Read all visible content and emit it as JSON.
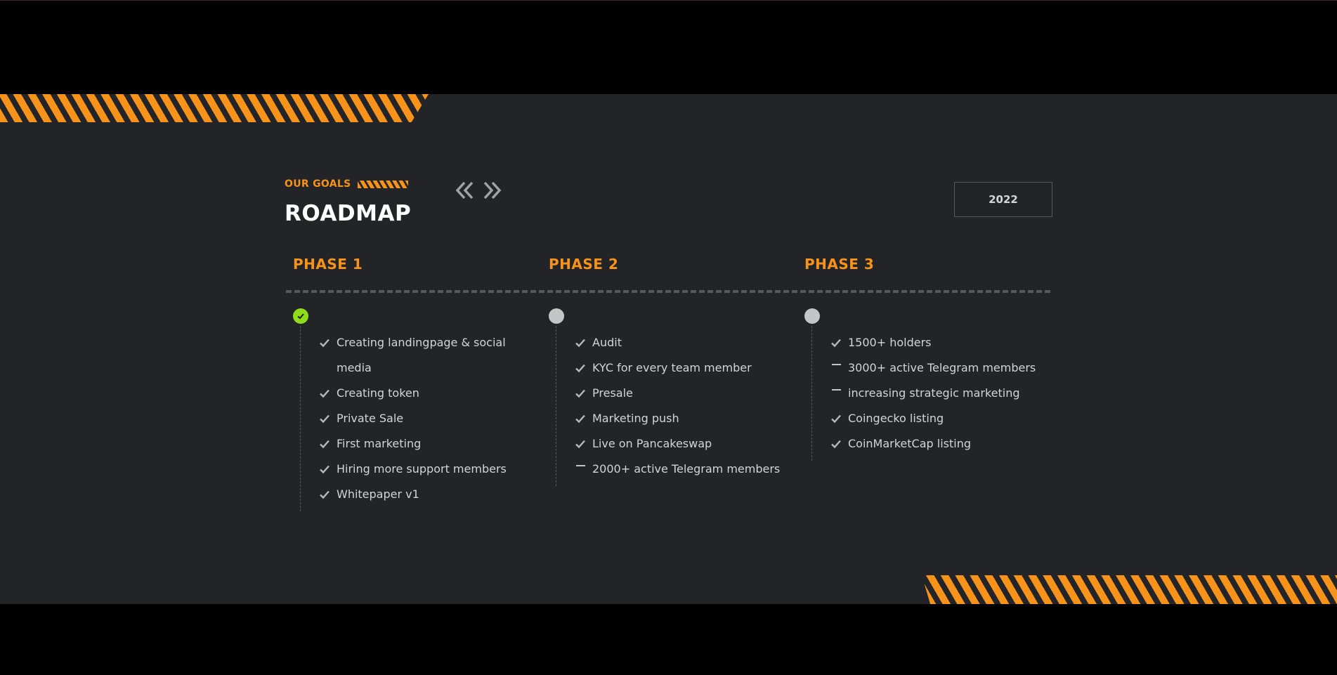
{
  "header": {
    "eyebrow": "OUR GOALS",
    "title": "ROADMAP",
    "year": "2022"
  },
  "colors": {
    "accent": "#f7931a",
    "done": "#8fdc1a",
    "pending": "#c4c5c7",
    "background": "#222428"
  },
  "phases": [
    {
      "title": "PHASE 1",
      "status": "done",
      "items": [
        {
          "text": "Creating landingpage & social media",
          "icon": "check-icon"
        },
        {
          "text": "Creating token",
          "icon": "check-icon"
        },
        {
          "text": "Private Sale",
          "icon": "check-icon"
        },
        {
          "text": "First marketing",
          "icon": "check-icon"
        },
        {
          "text": "Hiring more support members",
          "icon": "check-icon"
        },
        {
          "text": "Whitepaper v1",
          "icon": "check-icon"
        }
      ]
    },
    {
      "title": "PHASE 2",
      "status": "pending",
      "items": [
        {
          "text": "Audit",
          "icon": "check-icon"
        },
        {
          "text": "KYC for every team member",
          "icon": "check-icon"
        },
        {
          "text": "Presale",
          "icon": "check-icon"
        },
        {
          "text": "Marketing push",
          "icon": "check-icon"
        },
        {
          "text": "Live on Pancakeswap",
          "icon": "check-icon"
        },
        {
          "text": "2000+ active Telegram members",
          "icon": "dash-icon"
        }
      ]
    },
    {
      "title": "PHASE 3",
      "status": "pending",
      "items": [
        {
          "text": "1500+ holders",
          "icon": "check-icon"
        },
        {
          "text": "3000+ active Telegram members",
          "icon": "dash-icon"
        },
        {
          "text": "increasing strategic marketing",
          "icon": "dash-icon"
        },
        {
          "text": "Coingecko listing",
          "icon": "check-icon"
        },
        {
          "text": "CoinMarketCap listing",
          "icon": "check-icon"
        }
      ]
    }
  ]
}
